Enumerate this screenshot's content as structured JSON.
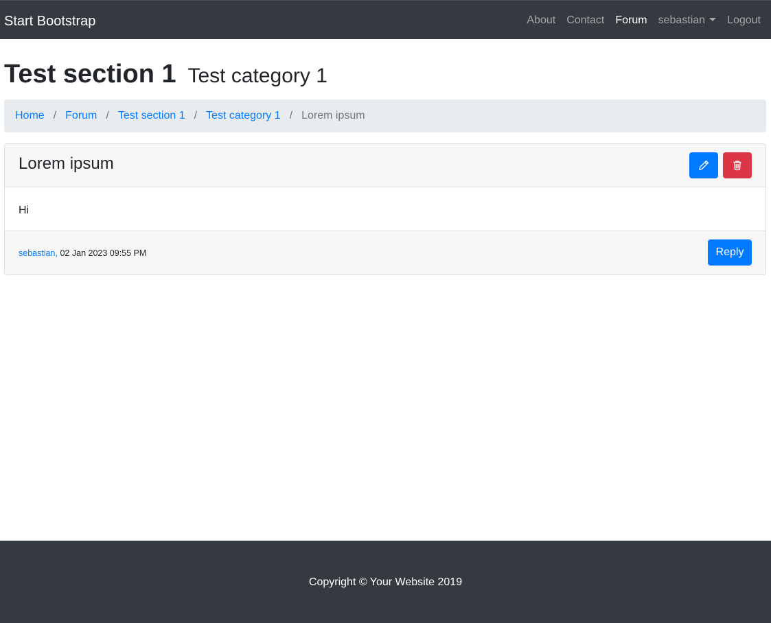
{
  "navbar": {
    "brand": "Start Bootstrap",
    "links": {
      "about": "About",
      "contact": "Contact",
      "forum": "Forum",
      "user": "sebastian",
      "logout": "Logout"
    },
    "active": "Forum"
  },
  "heading": {
    "section": "Test section 1",
    "category": "Test category 1"
  },
  "breadcrumb": {
    "home": "Home",
    "forum": "Forum",
    "section": "Test section 1",
    "category": "Test category 1",
    "current": "Lorem ipsum",
    "separator": "/"
  },
  "post": {
    "title": "Lorem ipsum",
    "body": "Hi",
    "author": "sebastian",
    "author_suffix": ",",
    "date": "02 Jan 2023 09:55 PM",
    "edit_icon": "pencil-icon",
    "delete_icon": "trash-icon",
    "reply_label": "Reply"
  },
  "footer": {
    "copyright": "Copyright © Your Website 2019"
  },
  "colors": {
    "primary": "#007bff",
    "danger": "#dc3545",
    "dark": "#343a40"
  }
}
